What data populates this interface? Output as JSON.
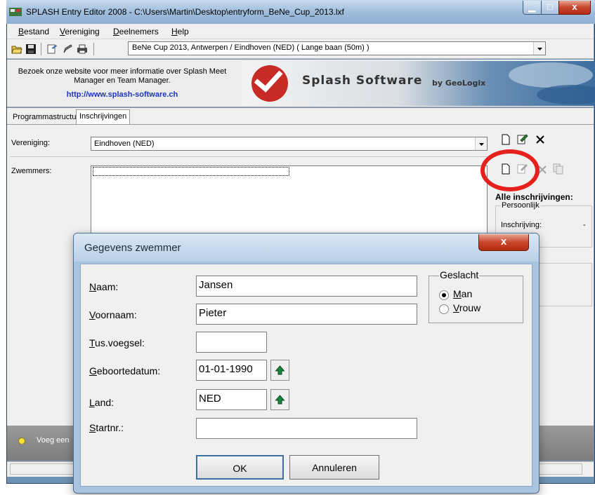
{
  "window": {
    "title": "SPLASH Entry Editor 2008 - C:\\Users\\Martin\\Desktop\\entryform_BeNe_Cup_2013.lxf",
    "close_glyph": "x"
  },
  "menu": [
    "Bestand",
    "Vereniging",
    "Deelnemers",
    "Help"
  ],
  "toolbar": {
    "meet_select": "BeNe Cup 2013,  Antwerpen / Eindhoven (NED)   ( Lange baan (50m) )"
  },
  "banner": {
    "info": "Bezoek onze website voor meer informatie over Splash Meet Manager en Team Manager.",
    "link": "http://www.splash-software.ch",
    "logo_text": "Splash Software",
    "by_text": "by GeoLogix"
  },
  "tabs": [
    "Programmastructuur",
    "Inschrijvingen"
  ],
  "club": {
    "label": "Vereniging:",
    "value": "Eindhoven (NED)"
  },
  "swimmers": {
    "label": "Zwemmers:"
  },
  "side_panel": {
    "heading": "Alle inschrijvingen:",
    "group": "Persoonlijk",
    "entry_label": "Inschrijving:",
    "entry_value": "-"
  },
  "status": {
    "text": "Voeg een"
  },
  "icons": {
    "new": "new-document-icon",
    "edit": "edit-icon",
    "delete": "delete-icon",
    "copy": "copy-icon",
    "open": "open-folder-icon",
    "save": "save-icon",
    "print": "print-icon",
    "bulb": "lightbulb-icon",
    "up": "up-arrow-icon"
  },
  "colors": {
    "highlight": "#e6201d",
    "link": "#1c35c2"
  },
  "dialog": {
    "title": "Gegevens zwemmer",
    "close_glyph": "x",
    "fields": {
      "naam": {
        "label": "Naam:",
        "value": "Jansen"
      },
      "voornaam": {
        "label": "Voornaam:",
        "value": "Pieter"
      },
      "tussenvoegsel": {
        "label": "Tus.voegsel:",
        "value": ""
      },
      "geboortedatum": {
        "label": "Geboortedatum:",
        "value": "01-01-1990"
      },
      "land": {
        "label": "Land:",
        "value": "NED"
      },
      "startnr": {
        "label": "Startnr.:",
        "value": ""
      }
    },
    "gender": {
      "legend": "Geslacht",
      "male": "Man",
      "female": "Vrouw",
      "selected": "male"
    },
    "ok": "OK",
    "cancel": "Annuleren"
  }
}
